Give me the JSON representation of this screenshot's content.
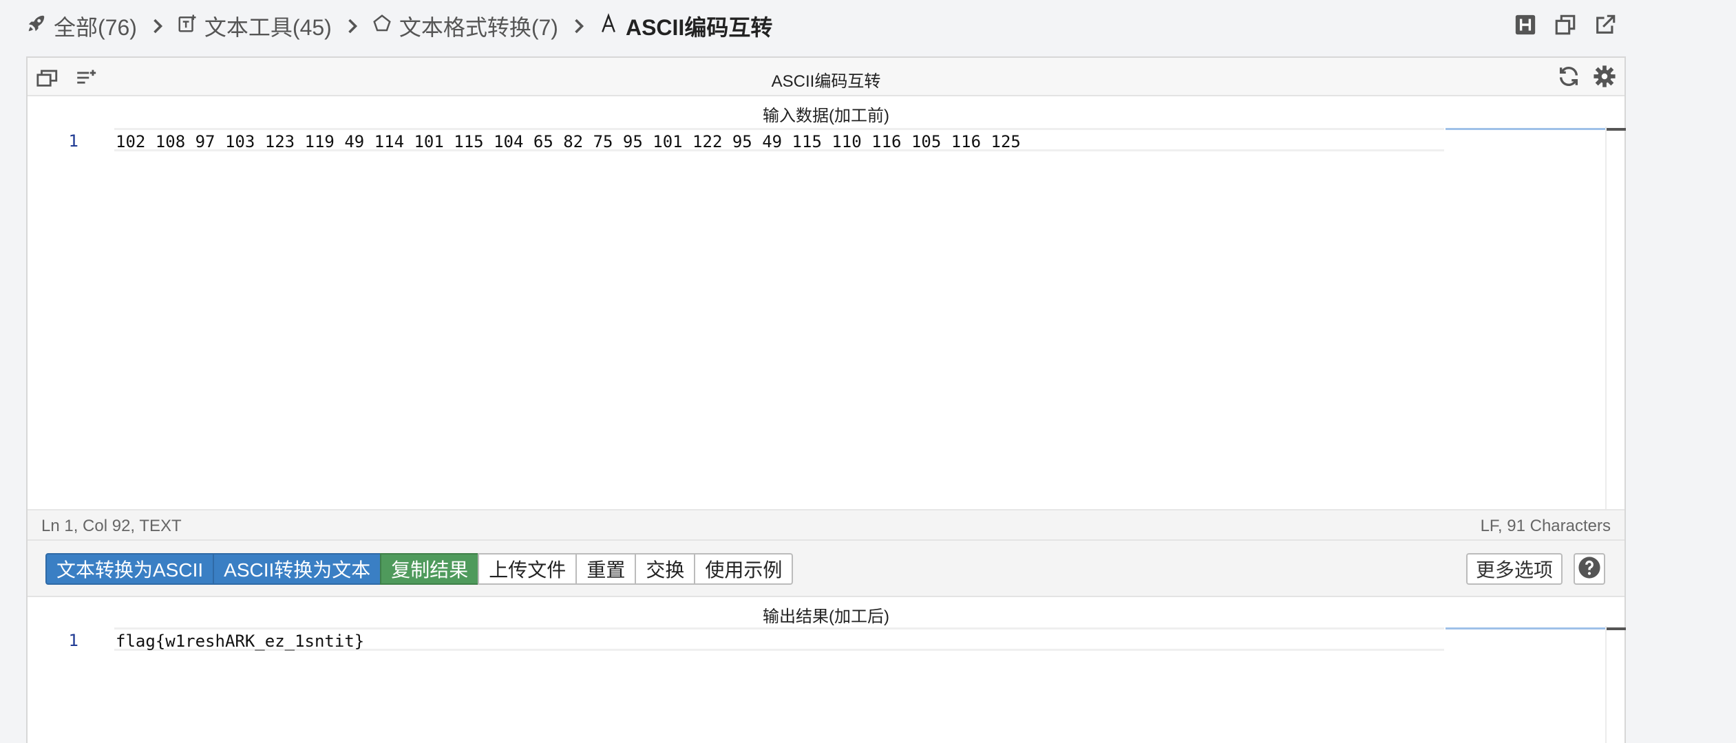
{
  "breadcrumb": {
    "items": [
      {
        "label": "全部(76)",
        "icon": "rocket-icon"
      },
      {
        "label": "文本工具(45)",
        "icon": "text-tool-icon"
      },
      {
        "label": "文本格式转换(7)",
        "icon": "pentagon-icon"
      },
      {
        "label": "ASCII编码互转",
        "icon": "letter-a-icon"
      }
    ]
  },
  "top_actions": [
    "header-toggle-icon",
    "window-icon",
    "external-link-icon"
  ],
  "panel": {
    "title": "ASCII编码互转",
    "left_icons": [
      "windows-icon",
      "list-add-icon"
    ],
    "right_icons": [
      "refresh-icon",
      "settings-icon"
    ]
  },
  "input": {
    "label": "输入数据(加工前)",
    "line_number": "1",
    "text": "102 108 97 103 123 119 49 114 101 115 104 65 82 75 95 101 122 95 49 115 110 116 105 116 125"
  },
  "status": {
    "left": "Ln 1, Col 92, TEXT",
    "right": "LF, 91 Characters"
  },
  "toolbar": {
    "buttons": [
      {
        "label": "文本转换为ASCII",
        "style": "blue"
      },
      {
        "label": "ASCII转换为文本",
        "style": "blue"
      },
      {
        "label": "复制结果",
        "style": "green"
      },
      {
        "label": "上传文件",
        "style": "default"
      },
      {
        "label": "重置",
        "style": "default"
      },
      {
        "label": "交换",
        "style": "default"
      },
      {
        "label": "使用示例",
        "style": "default"
      }
    ],
    "more_options": "更多选项",
    "help_icon": "question-circle-icon"
  },
  "output": {
    "label": "输出结果(加工后)",
    "line_number": "1",
    "text": "flag{w1reshARK_ez_1sntit}"
  },
  "colors": {
    "blue": "#3a7fc4",
    "green": "#4f9a5c",
    "line_number": "#1f3a93"
  }
}
